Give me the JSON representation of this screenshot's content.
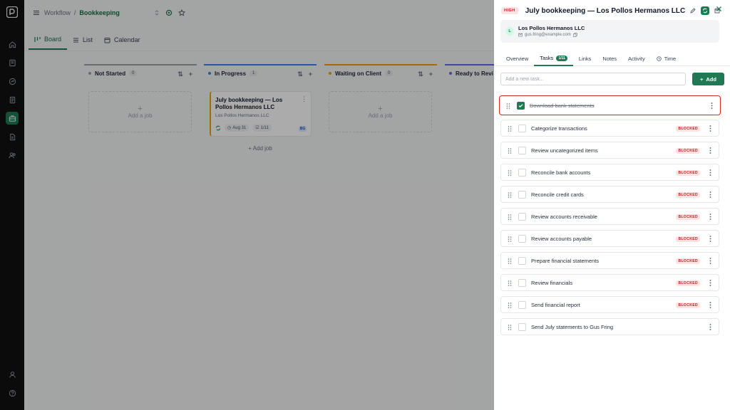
{
  "colors": {
    "accent": "#1f7a54",
    "blocked": "#b91c1c",
    "highlight": "#dc2626"
  },
  "breadcrumb": {
    "root": "Workflow",
    "separator": "/",
    "current": "Bookkeeping"
  },
  "views": [
    {
      "label": "Board",
      "icon": "board-icon"
    },
    {
      "label": "List",
      "icon": "list-icon"
    },
    {
      "label": "Calendar",
      "icon": "calendar-icon"
    }
  ],
  "board": {
    "columns": [
      {
        "title": "Not Started",
        "count": "0",
        "color": "#9ca3af",
        "add_label": "Add a job"
      },
      {
        "title": "In Progress",
        "count": "1",
        "color": "#3b82f6",
        "add_label": "Add job"
      },
      {
        "title": "Waiting on Client",
        "count": "0",
        "color": "#f59e0b",
        "add_label": "Add a job"
      },
      {
        "title": "Ready to Revi",
        "count": "",
        "color": "#6366f1",
        "add_label": ""
      }
    ],
    "job_card": {
      "title": "July bookkeeping — Los Pollos Hermanos LLC",
      "client": "Los Pollos Hermanos LLC",
      "due": "Aug 31",
      "progress": "1/11",
      "assignee": "BG"
    }
  },
  "panel": {
    "priority": "HIGH",
    "title": "July bookkeeping — Los Pollos Hermanos LLC",
    "client": {
      "initial": "L",
      "name": "Los Pollos Hermanos LLC",
      "email": "gus.fring@example.com"
    },
    "tabs": [
      {
        "label": "Overview",
        "badge": ""
      },
      {
        "label": "Tasks",
        "badge": "1/11"
      },
      {
        "label": "Links",
        "badge": ""
      },
      {
        "label": "Notes",
        "badge": ""
      },
      {
        "label": "Activity",
        "badge": ""
      },
      {
        "label": "Time",
        "badge": ""
      }
    ],
    "new_task_placeholder": "Add a new task...",
    "add_label": "Add",
    "blocked_label": "BLOCKED",
    "tasks": [
      {
        "label": "Download bank statements",
        "done": true,
        "blocked": false
      },
      {
        "label": "Categorize transactions",
        "done": false,
        "blocked": true
      },
      {
        "label": "Review uncategorized items",
        "done": false,
        "blocked": true
      },
      {
        "label": "Reconcile bank accounts",
        "done": false,
        "blocked": true
      },
      {
        "label": "Reconcile credit cards",
        "done": false,
        "blocked": true
      },
      {
        "label": "Review accounts receivable",
        "done": false,
        "blocked": true
      },
      {
        "label": "Review accounts payable",
        "done": false,
        "blocked": true
      },
      {
        "label": "Prepare financial statements",
        "done": false,
        "blocked": true
      },
      {
        "label": "Review financials",
        "done": false,
        "blocked": true
      },
      {
        "label": "Send financial report",
        "done": false,
        "blocked": true
      },
      {
        "label": "Send July statements to Gus Fring",
        "done": false,
        "blocked": false
      }
    ]
  }
}
